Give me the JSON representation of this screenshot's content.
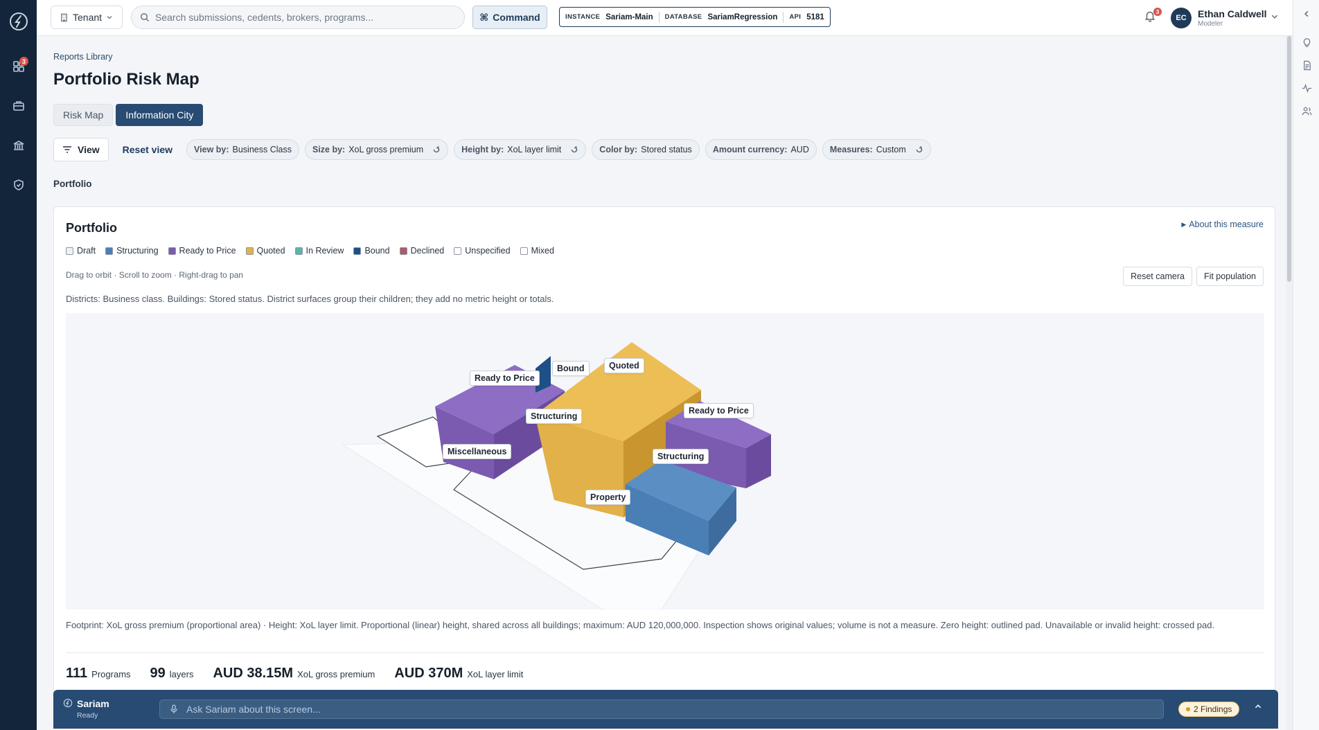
{
  "rail": {
    "dashboard_badge": "3"
  },
  "topbar": {
    "tenant_label": "Tenant",
    "search_placeholder": "Search submissions, cedents, brokers, programs...",
    "command_label": "Command",
    "env": {
      "instance_key": "INSTANCE",
      "instance_value": "Sariam-Main",
      "database_key": "DATABASE",
      "database_value": "SariamRegression",
      "api_key": "API",
      "api_value": "5181"
    },
    "notifications_badge": "3",
    "user": {
      "initials": "EC",
      "name": "Ethan Caldwell",
      "role": "Modeler"
    }
  },
  "page": {
    "breadcrumb": "Reports Library",
    "title": "Portfolio Risk Map",
    "tabs": [
      {
        "label": "Risk Map",
        "active": false
      },
      {
        "label": "Information City",
        "active": true
      }
    ],
    "toolbar": {
      "view_label": "View",
      "reset_view_label": "Reset view",
      "chips": [
        {
          "key": "View by:",
          "value": "Business Class"
        },
        {
          "key": "Size by:",
          "value": "XoL gross premium"
        },
        {
          "key": "Height by:",
          "value": "XoL layer limit"
        },
        {
          "key": "Color by:",
          "value": "Stored status"
        },
        {
          "key": "Amount currency:",
          "value": "AUD"
        },
        {
          "key": "Measures:",
          "value": "Custom"
        }
      ]
    },
    "section_label": "Portfolio"
  },
  "card": {
    "title": "Portfolio",
    "about_label": "About this measure",
    "legend": [
      {
        "label": "Draft",
        "color": "#eef2f7"
      },
      {
        "label": "Structuring",
        "color": "#4a7fb5"
      },
      {
        "label": "Ready to Price",
        "color": "#7b5bb0"
      },
      {
        "label": "Quoted",
        "color": "#e3b14a"
      },
      {
        "label": "In Review",
        "color": "#5ab5a8"
      },
      {
        "label": "Bound",
        "color": "#1e4f86"
      },
      {
        "label": "Declined",
        "color": "#b35a66"
      },
      {
        "label": "Unspecified",
        "color": "#ffffff"
      },
      {
        "label": "Mixed",
        "color": "#ffffff"
      }
    ],
    "hint": "Drag to orbit · Scroll to zoom · Right-drag to pan",
    "reset_camera_label": "Reset camera",
    "fit_population_label": "Fit population",
    "districts_text": "Districts: Business class. Buildings: Stored status. District surfaces group their children; they add no metric height or totals.",
    "scene_labels": {
      "ready_to_price_left": "Ready to Price",
      "bound": "Bound",
      "quoted": "Quoted",
      "structuring_center": "Structuring",
      "ready_to_price_right": "Ready to Price",
      "miscellaneous": "Miscellaneous",
      "structuring_right": "Structuring",
      "property": "Property"
    },
    "footnote": "Footprint: XoL gross premium (proportional area) · Height: XoL layer limit. Proportional (linear) height, shared across all buildings; maximum: AUD 120,000,000. Inspection shows original values; volume is not a measure. Zero height: outlined pad. Unavailable or invalid height: crossed pad.",
    "stats": [
      {
        "value": "111",
        "label": "Programs"
      },
      {
        "value": "99",
        "label": "layers"
      },
      {
        "value": "AUD 38.15M",
        "label": "XoL gross premium"
      },
      {
        "value": "AUD 370M",
        "label": "XoL layer limit"
      }
    ]
  },
  "assistant": {
    "name": "Sariam",
    "status": "Ready",
    "ask_placeholder": "Ask Sariam about this screen...",
    "findings_label": "2 Findings"
  }
}
